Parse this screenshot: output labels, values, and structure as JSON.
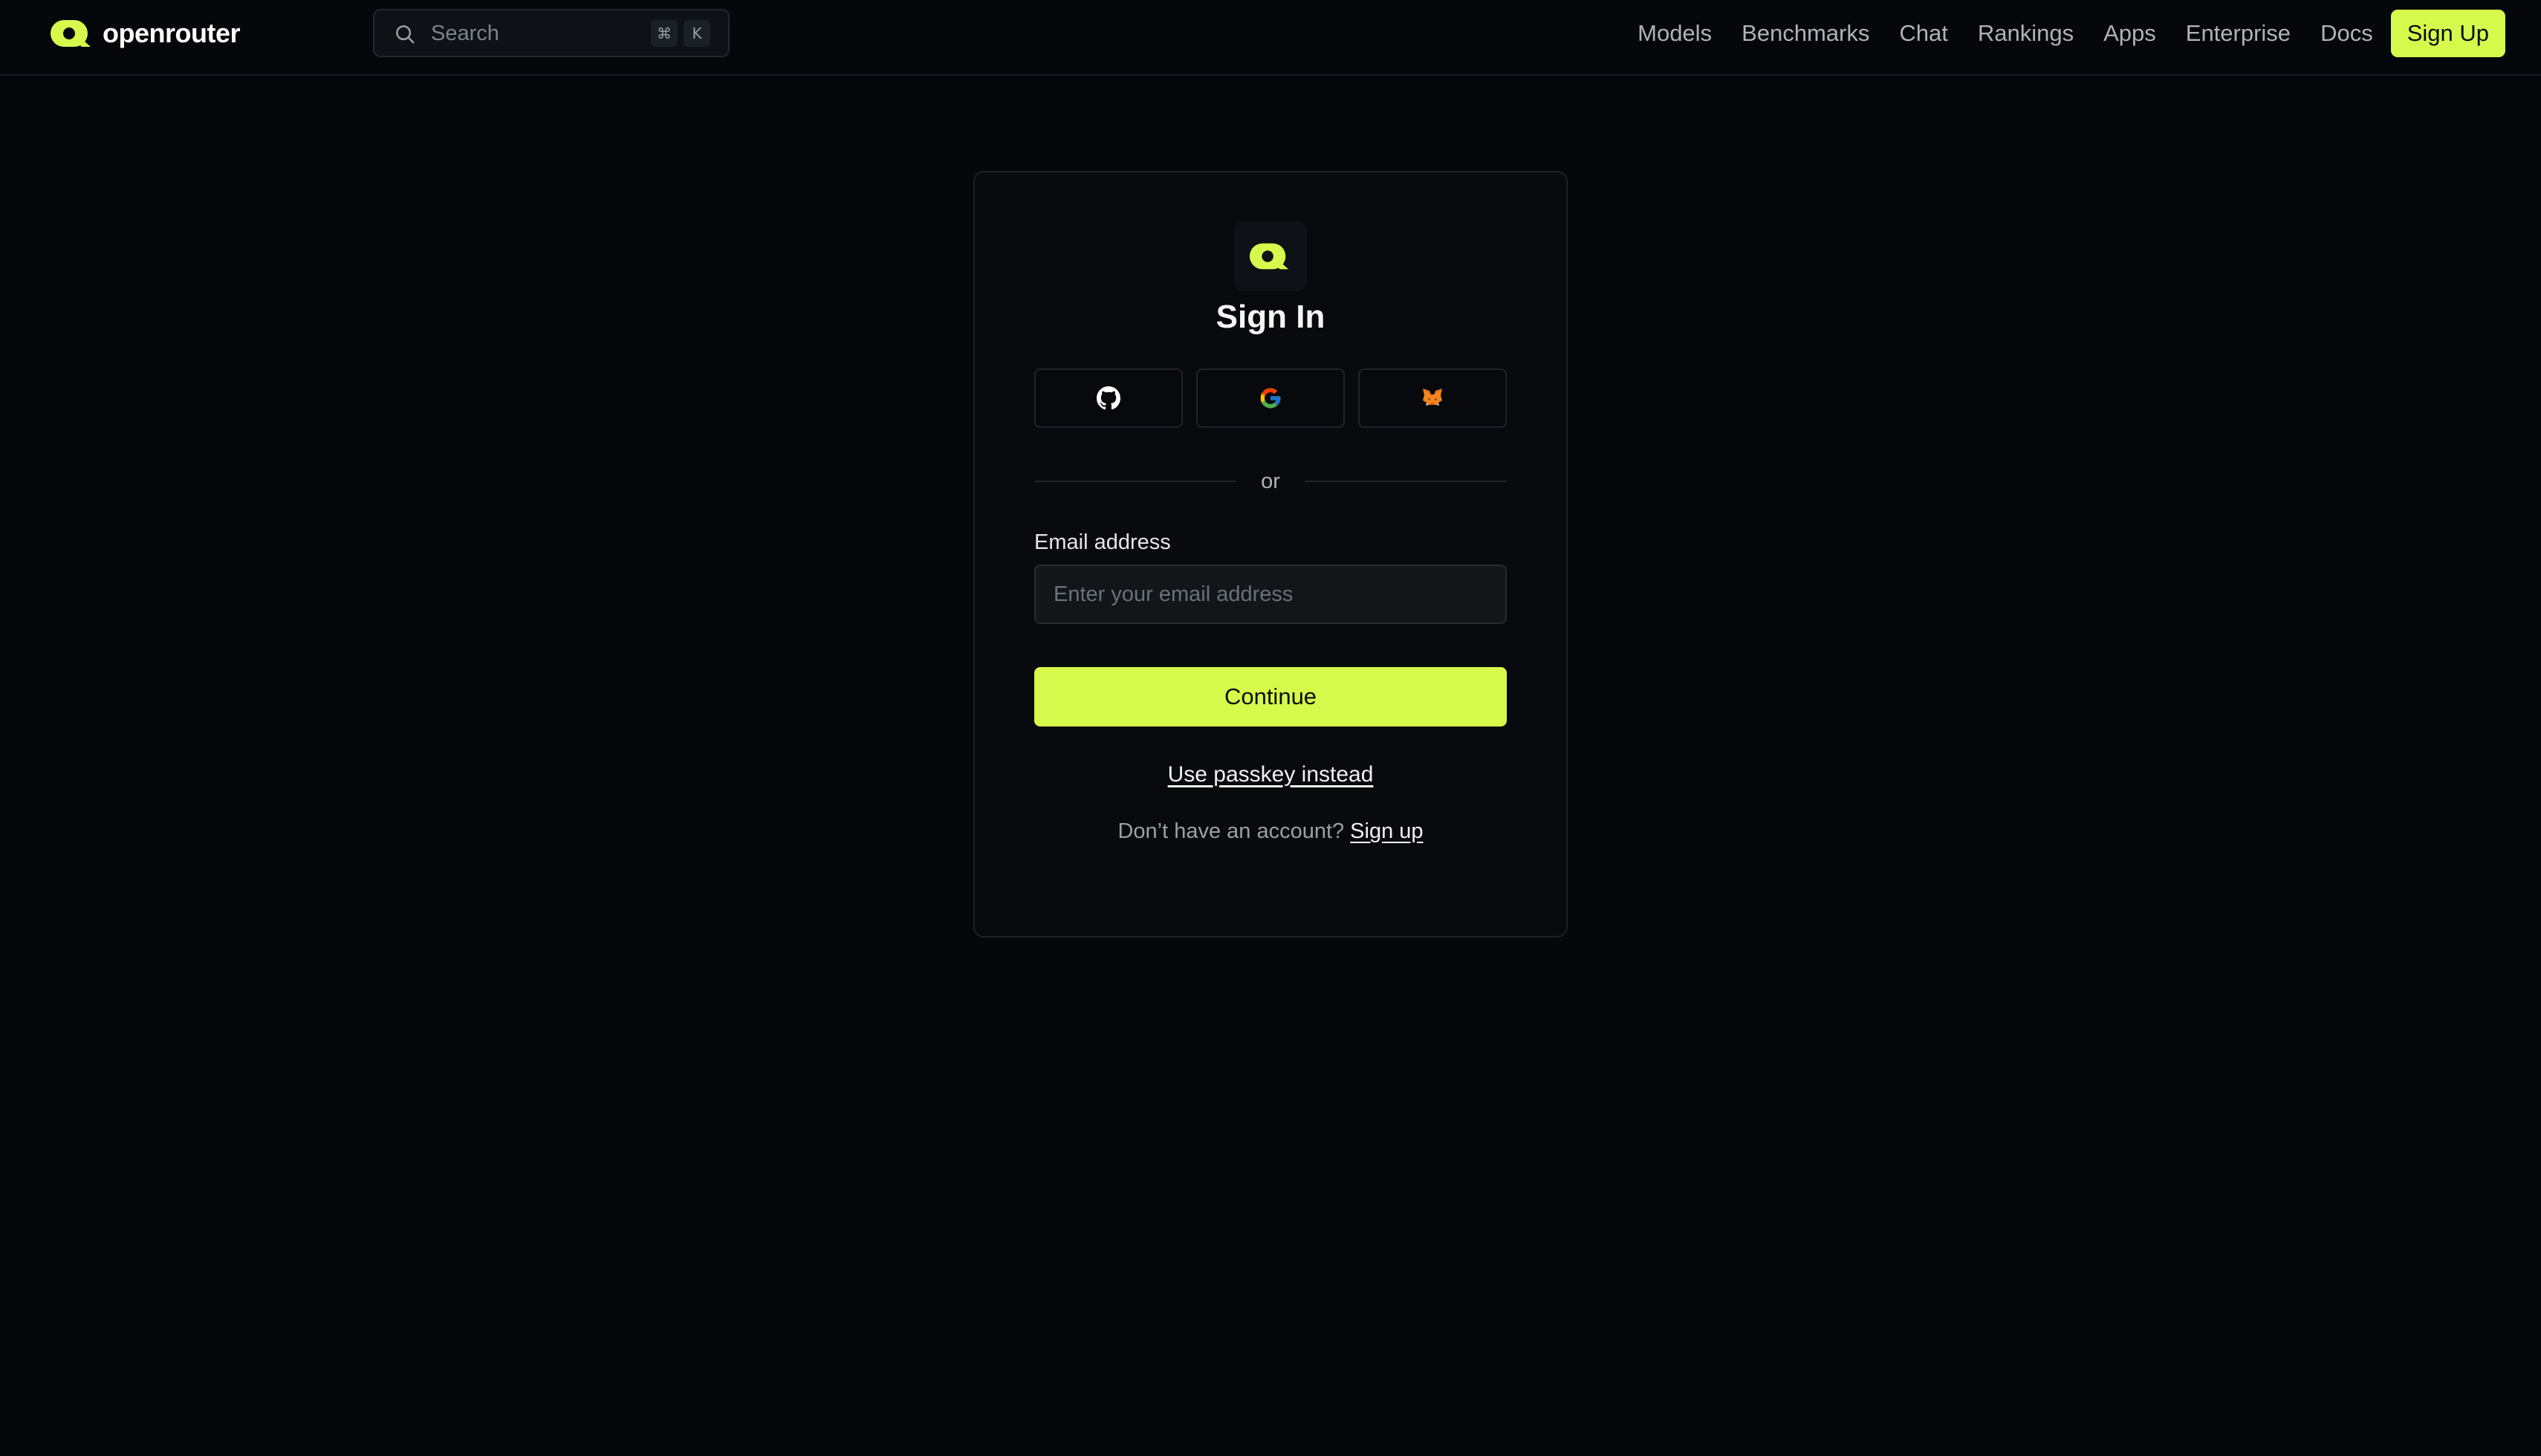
{
  "brand": {
    "name": "openrouter",
    "accent_color": "#d6fa4c"
  },
  "search": {
    "placeholder": "Search",
    "shortcut_modifier": "⌘",
    "shortcut_key": "K"
  },
  "nav": {
    "links": [
      "Models",
      "Benchmarks",
      "Chat",
      "Rankings",
      "Apps",
      "Enterprise",
      "Docs"
    ],
    "signup_label": "Sign Up"
  },
  "signin": {
    "title": "Sign In",
    "providers": [
      {
        "name": "github",
        "icon": "github-icon"
      },
      {
        "name": "google",
        "icon": "google-icon"
      },
      {
        "name": "metamask",
        "icon": "metamask-icon"
      }
    ],
    "divider_text": "or",
    "email_label": "Email address",
    "email_placeholder": "Enter your email address",
    "email_value": "",
    "continue_label": "Continue",
    "passkey_label": "Use passkey instead",
    "no_account_text": "Don’t have an account?",
    "signup_link_label": "Sign up"
  }
}
